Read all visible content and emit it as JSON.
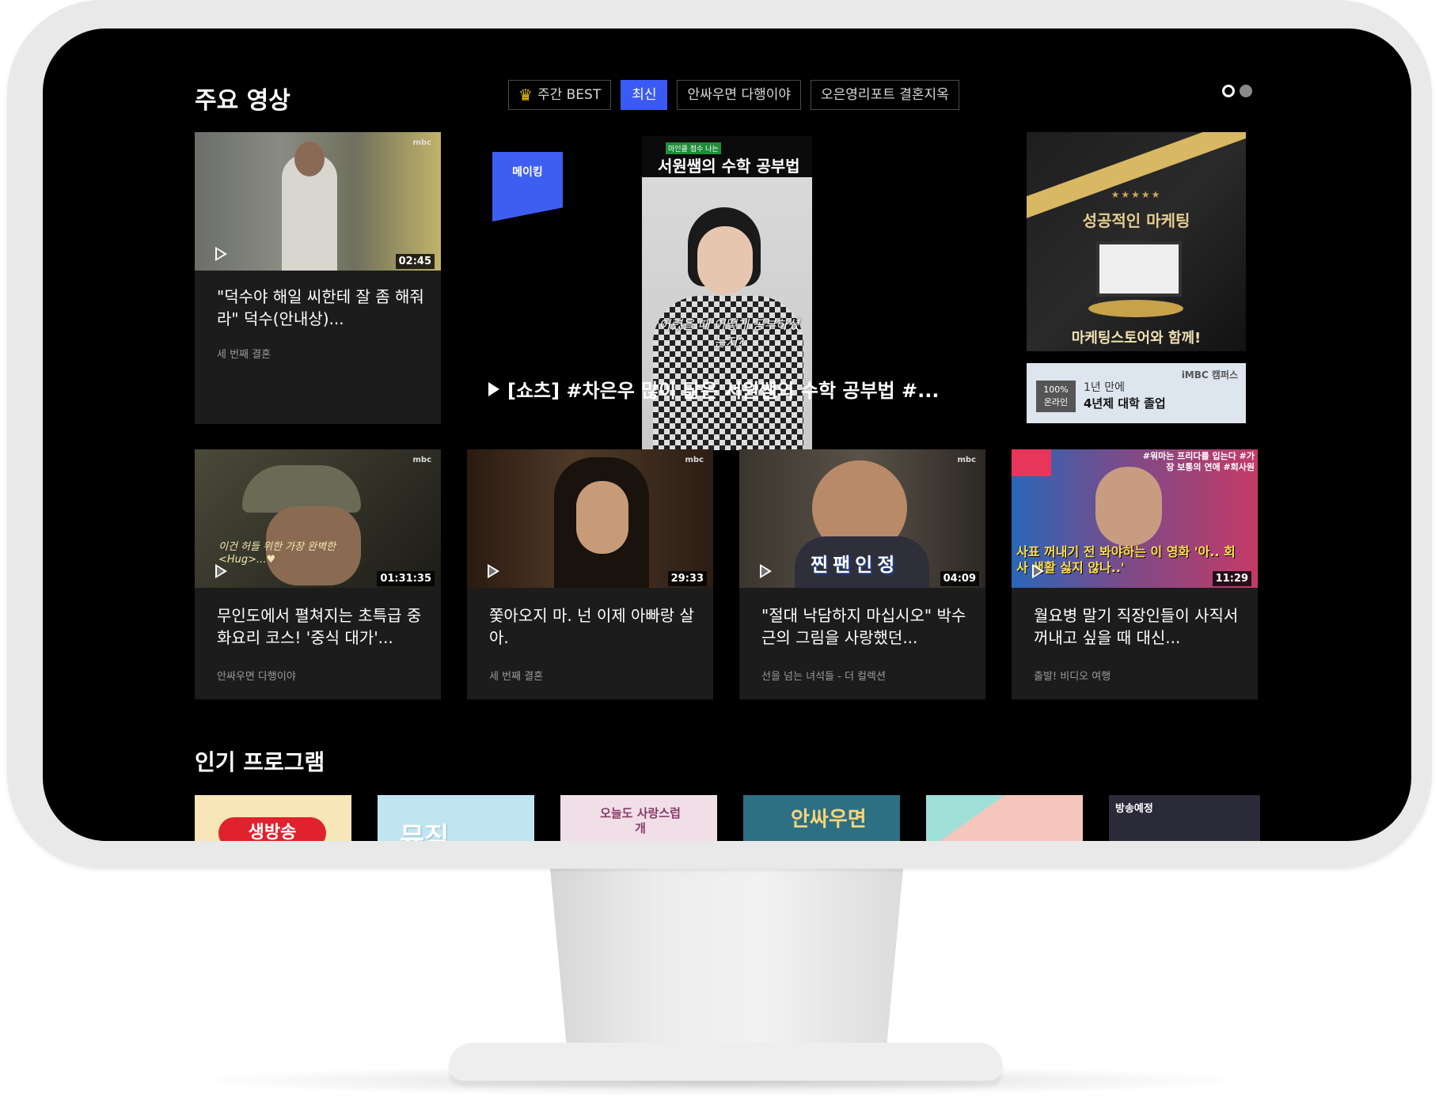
{
  "section_main": {
    "title": "주요 영상"
  },
  "tabs": [
    {
      "label": "주간 BEST",
      "icon": "crown-icon",
      "active": false
    },
    {
      "label": "최신",
      "active": true
    },
    {
      "label": "안싸우면 다행이야",
      "active": false
    },
    {
      "label": "오은영리포트 결혼지옥",
      "active": false
    }
  ],
  "pager": {
    "pages": 2,
    "current": 1
  },
  "top_card": {
    "brand": "mbc",
    "duration": "02:45",
    "title": "\"덕수야 해일 씨한테 잘 좀 해줘라\" 덕수(안내상)...",
    "program": "세 번째 결혼"
  },
  "feature": {
    "badge": "메이킹",
    "thumb_header_small": "마인클 점수 나는",
    "thumb_header": "서원쌤의 수학 공부법",
    "thumb_subtitle": "어렸을 때 어떻게 공부하셨는지?",
    "caption": "[쇼츠] #차은우 많이 닮은 서원쌤의 수학 공부법 #..."
  },
  "ads": {
    "ad1_stars": "★★★★★",
    "ad1_title": "성공적인 마케팅",
    "ad1_footer": "마케팅스토어와 함께!",
    "ad2_badge_top": "100%",
    "ad2_badge_bottom": "온라인",
    "ad2_line1": "1년 만에",
    "ad2_line2": "4년제 대학 졸업",
    "ad2_brand": "iMBC 캠퍼스"
  },
  "video_cards": [
    {
      "brand": "mbc",
      "duration": "01:31:35",
      "title": "무인도에서 펼쳐지는 초특급 중화요리 코스! '중식 대가'...",
      "program": "안싸우면 다행이야",
      "thumb_text": "이건 허들 위한 가장 완벽한 <Hug>...♥",
      "colors": [
        "#3b3a30",
        "#1d1c18"
      ]
    },
    {
      "brand": "mbc",
      "duration": "29:33",
      "title": "쫓아오지 마. 넌 이제 아빠랑 살아.",
      "program": "세 번째 결혼",
      "thumb_text": "",
      "colors": [
        "#4a3424",
        "#1e140d"
      ]
    },
    {
      "brand": "mbc",
      "duration": "04:09",
      "title": "\"절대 낙담하지 마십시오\" 박수근의 그림을 사랑했던...",
      "program": "선을 넘는 녀석들 - 더 컬렉션",
      "thumb_text": "찐팬인정",
      "colors": [
        "#4b463e",
        "#23201c"
      ]
    },
    {
      "brand": "",
      "duration": "11:29",
      "title": "월요병 말기 직장인들이 사직서 꺼내고 싶을 때 대신...",
      "program": "출발! 비디오 여행",
      "thumb_text": "사표 꺼내기 전 봐야하는 이 영화 '아.. 회사 생활 싫지 않나..'",
      "thumb_tags": "#워마는 프리다를 입는다 #가장 보통의 연애 #회사원",
      "colors": [
        "#2a66b8",
        "#c43a66"
      ]
    }
  ],
  "section_popular": {
    "title": "인기 프로그램"
  },
  "programs": [
    {
      "label": "생방송",
      "bg": "#f6e6b8"
    },
    {
      "label": "뮤직",
      "bg": "#bfe5f3"
    },
    {
      "label": "오늘도 사랑스럽개",
      "bg": "#f0dfe6"
    },
    {
      "label": "안싸우면",
      "bg": "#2d6f83"
    },
    {
      "label": "",
      "bg": "#f5c6bb"
    },
    {
      "label": "방송예정",
      "bg": "#2a2a38"
    }
  ]
}
